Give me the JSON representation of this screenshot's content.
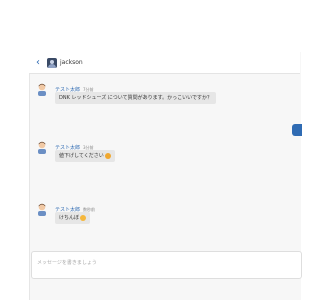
{
  "header": {
    "back_glyph": "‹",
    "contact_name": "jackson"
  },
  "messages": [
    {
      "name": "テスト太郎",
      "time": "7分前",
      "text": "DNK レッドシューズ について質問があります。かっこいいですか？",
      "emoji": ""
    },
    {
      "name": "テスト太郎",
      "time": "3分前",
      "text": "値下げしてください",
      "emoji": "crying-face"
    },
    {
      "name": "テスト太郎",
      "time": "数秒前",
      "text": "けちんぼ",
      "emoji": "angry-face"
    }
  ],
  "composer": {
    "placeholder": "メッセージを書きましょう"
  },
  "colors": {
    "accent": "#2f6bb3",
    "bubble": "#e6e6e6",
    "panel": "#f7f7f7"
  }
}
